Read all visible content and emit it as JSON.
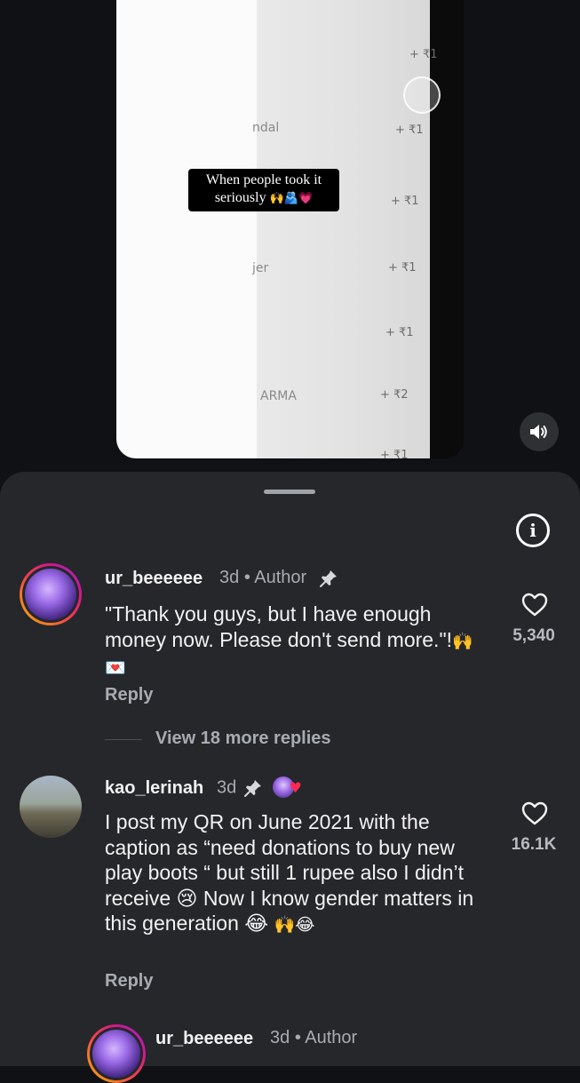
{
  "video": {
    "caption_line1": "When people took it",
    "caption_line2": "seriously",
    "caption_emoji": "🙌🫂💗",
    "amounts": [
      "+ ₹1",
      "+ ₹1",
      "+ ₹1",
      "+ ₹1",
      "+ ₹1",
      "+ ₹2",
      "+ ₹1"
    ],
    "partial_names": [
      "ndal",
      "jer",
      "ARMA"
    ],
    "sound_icon": "speaker-icon"
  },
  "sheet": {
    "info_icon": "info-icon",
    "comments": [
      {
        "username": "ur_beeeeee",
        "time": "3d",
        "separator": "•",
        "badge": "Author",
        "text": "\"Thank you guys, but I have enough money now. Please don't send more.\"!",
        "text_emoji": "🙌💌",
        "reply_label": "Reply",
        "likes": "5,340"
      },
      {
        "username": "kao_lerinah",
        "time": "3d",
        "text": "I post my QR on June 2021 with the caption as “need donations to buy new play boots “ but still 1 rupee also I didn’t receive 😢 Now I know gender matters in this generation 😂",
        "text_emoji": "🙌😂",
        "reply_label": "Reply",
        "likes": "16.1K"
      }
    ],
    "view_more_replies": "View 18 more replies",
    "nested_reply": {
      "username": "ur_beeeeee",
      "time": "3d",
      "separator": "•",
      "badge": "Author"
    }
  },
  "colors": {
    "background": "#0f1115",
    "sheet": "#25272b",
    "muted_text": "#a8abb1",
    "primary_text": "#f2f2f2"
  }
}
